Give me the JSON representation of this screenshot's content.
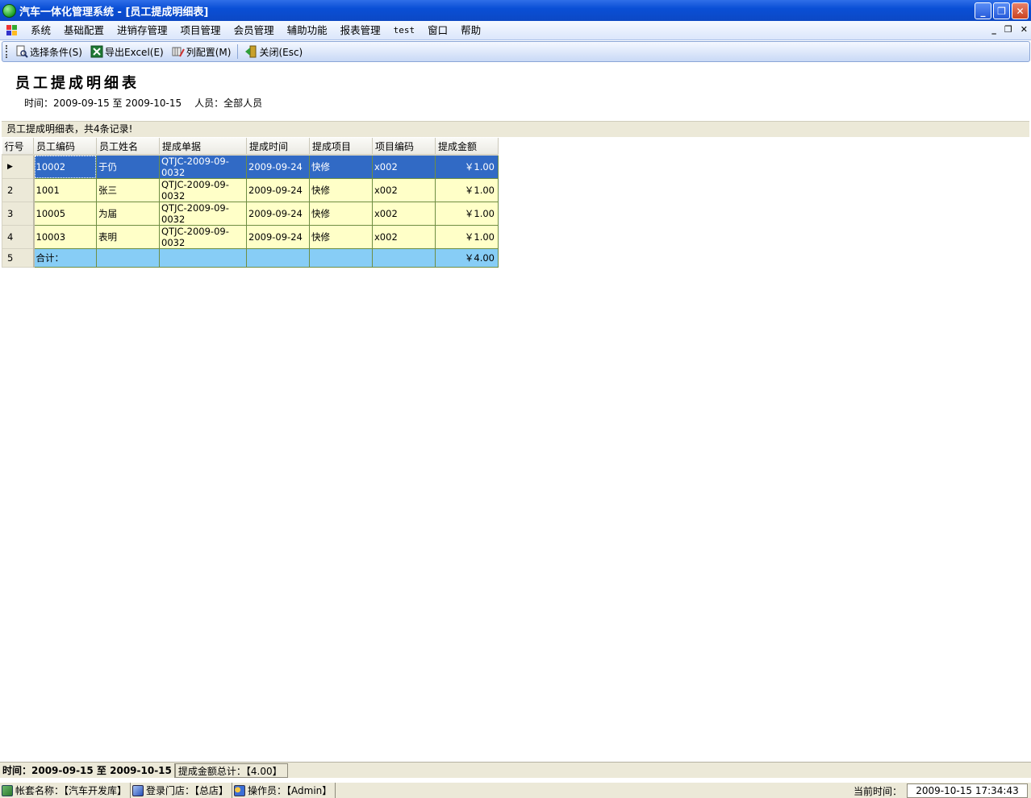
{
  "window": {
    "title": "汽车一体化管理系统 - [员工提成明细表]",
    "minimize_glyph": "_",
    "restore_glyph": "❐",
    "close_glyph": "✕"
  },
  "menu": {
    "items": [
      "系统",
      "基础配置",
      "进销存管理",
      "项目管理",
      "会员管理",
      "辅助功能",
      "报表管理",
      "test",
      "窗口",
      "帮助"
    ],
    "mdi_minimize": "_",
    "mdi_restore": "❐",
    "mdi_close": "✕"
  },
  "toolbar": {
    "select_label": "选择条件(S)",
    "export_label": "导出Excel(E)",
    "columns_label": "列配置(M)",
    "close_label": "关闭(Esc)"
  },
  "report": {
    "title": "员工提成明细表",
    "time_text": "时间：2009-09-15 至 2009-10-15",
    "person_text": "人员：全部人员"
  },
  "grid": {
    "caption": "员工提成明细表，共4条记录!",
    "headers": [
      "行号",
      "员工编码",
      "员工姓名",
      "提成单据",
      "提成时间",
      "提成项目",
      "项目编码",
      "提成金额"
    ],
    "rows": [
      {
        "no": "",
        "code": "10002",
        "name": "于仍",
        "doc": "QTJC-2009-09-0032",
        "date": "2009-09-24",
        "item": "快修",
        "item_code": "x002",
        "amount": "￥1.00"
      },
      {
        "no": "2",
        "code": "1001",
        "name": "张三",
        "doc": "QTJC-2009-09-0032",
        "date": "2009-09-24",
        "item": "快修",
        "item_code": "x002",
        "amount": "￥1.00"
      },
      {
        "no": "3",
        "code": "10005",
        "name": "为届",
        "doc": "QTJC-2009-09-0032",
        "date": "2009-09-24",
        "item": "快修",
        "item_code": "x002",
        "amount": "￥1.00"
      },
      {
        "no": "4",
        "code": "10003",
        "name": "表明",
        "doc": "QTJC-2009-09-0032",
        "date": "2009-09-24",
        "item": "快修",
        "item_code": "x002",
        "amount": "￥1.00"
      }
    ],
    "total": {
      "no": "5",
      "label": "合计：",
      "amount": "￥4.00"
    },
    "row_indicator": "▶"
  },
  "status": {
    "time_range": "时间：2009-09-15 至 2009-10-15",
    "total_amount": "提成金额总计：【4.00】",
    "account": "帐套名称：【汽车开发库】",
    "store": "登录门店：【总店】",
    "operator": "操作员：【Admin】",
    "current_time_label": "当前时间：",
    "current_time": "2009-10-15 17:34:43"
  },
  "colors": {
    "selected_row": "#316ac5",
    "data_row": "#ffffc8",
    "total_row": "#87cdf6",
    "titlebar": "#0a4fd6"
  }
}
